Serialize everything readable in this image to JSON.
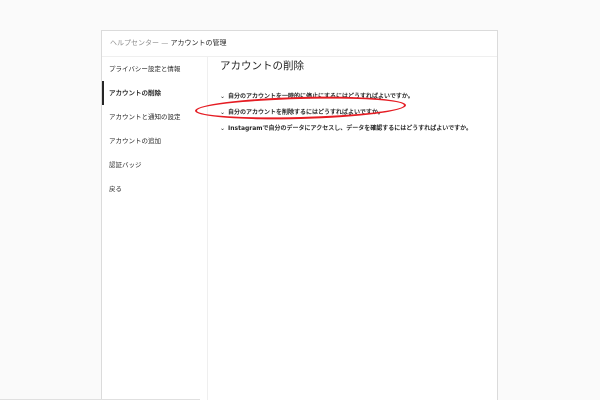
{
  "breadcrumb": {
    "parent": "ヘルプセンター",
    "separator": " — ",
    "current": "アカウントの管理"
  },
  "sidebar": {
    "items": [
      {
        "label": "プライバシー設定と情報"
      },
      {
        "label": "アカウントの削除"
      },
      {
        "label": "アカウントと通知の設定"
      },
      {
        "label": "アカウントの追加"
      },
      {
        "label": "認証バッジ"
      },
      {
        "label": "戻る"
      }
    ],
    "active_index": 1
  },
  "main": {
    "title": "アカウントの削除",
    "faq": [
      {
        "label": "自分のアカウントを一時的に停止にするにはどうすればよいですか。"
      },
      {
        "label": "自分のアカウントを削除するにはどうすればよいですか。"
      },
      {
        "label": "Instagramで自分のデータにアクセスし、データを確認するにはどうすればよいですか。"
      }
    ],
    "chevron_glyph": "⌄"
  },
  "colors": {
    "annotation": "#e51c23",
    "border": "#dbdbdb",
    "text": "#262626",
    "muted": "#8e8e8e"
  }
}
